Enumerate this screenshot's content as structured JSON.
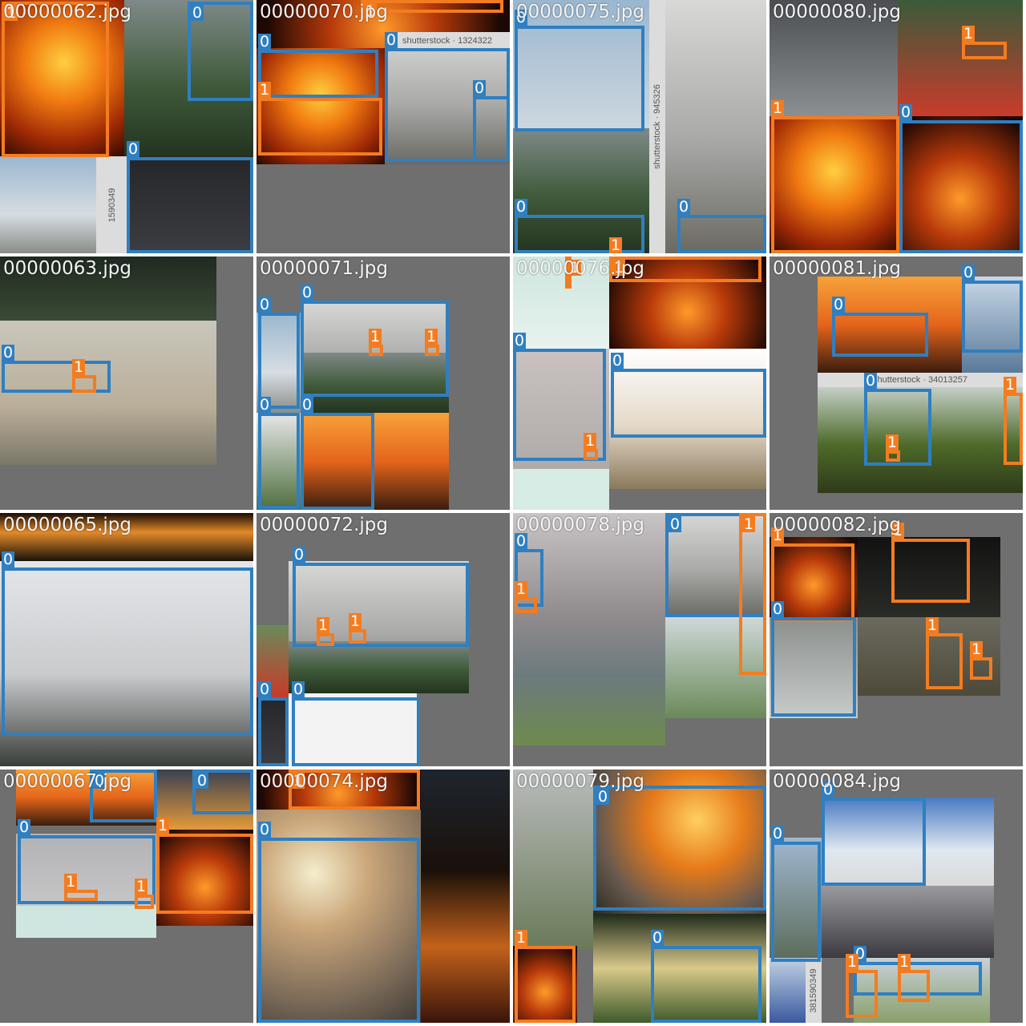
{
  "classes": {
    "0": {
      "label": "0",
      "color": "#2f7fc1"
    },
    "1": {
      "label": "1",
      "color": "#f47c20"
    }
  },
  "tiles": [
    {
      "title": "00000062.jpg"
    },
    {
      "title": "00000070.jpg"
    },
    {
      "title": "00000075.jpg"
    },
    {
      "title": "00000080.jpg"
    },
    {
      "title": "00000063.jpg"
    },
    {
      "title": "00000071.jpg"
    },
    {
      "title": "00000076.jpg"
    },
    {
      "title": "00000081.jpg"
    },
    {
      "title": "00000065.jpg"
    },
    {
      "title": "00000072.jpg"
    },
    {
      "title": "00000078.jpg"
    },
    {
      "title": "00000082.jpg"
    },
    {
      "title": "00000067.jpg"
    },
    {
      "title": "00000074.jpg"
    },
    {
      "title": "00000079.jpg"
    },
    {
      "title": "00000084.jpg"
    }
  ],
  "watermarks": {
    "w1": "shutterstock · 1324322",
    "w2": "shutterstock · 945326",
    "w3": "shutterstock · 34013257",
    "w4": "1590349",
    "w5": "381590349"
  }
}
